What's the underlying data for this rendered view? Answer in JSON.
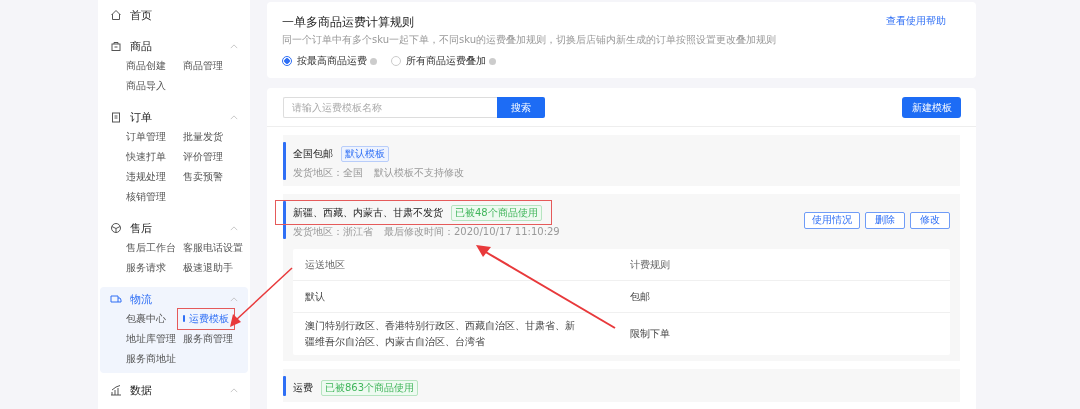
{
  "sidebar": {
    "items": [
      {
        "label": "首页",
        "expanded": false,
        "active": false
      },
      {
        "label": "商品",
        "expanded": true,
        "active": false,
        "children": [
          {
            "label": "商品创建",
            "selected": false
          },
          {
            "label": "商品管理",
            "selected": false
          },
          {
            "label": "商品导入",
            "selected": false
          }
        ]
      },
      {
        "label": "订单",
        "expanded": true,
        "active": false,
        "children": [
          {
            "label": "订单管理",
            "selected": false
          },
          {
            "label": "批量发货",
            "selected": false
          },
          {
            "label": "快速打单",
            "selected": false
          },
          {
            "label": "评价管理",
            "selected": false
          },
          {
            "label": "违规处理",
            "selected": false
          },
          {
            "label": "售卖预警",
            "selected": false
          },
          {
            "label": "核销管理",
            "selected": false
          }
        ]
      },
      {
        "label": "售后",
        "expanded": true,
        "active": false,
        "children": [
          {
            "label": "售后工作台",
            "selected": false
          },
          {
            "label": "客服电话设置",
            "selected": false
          },
          {
            "label": "服务请求",
            "selected": false
          },
          {
            "label": "极速退助手",
            "selected": false
          }
        ]
      },
      {
        "label": "物流",
        "expanded": true,
        "active": true,
        "children": [
          {
            "label": "包裹中心",
            "selected": false
          },
          {
            "label": "运费模板",
            "selected": true
          },
          {
            "label": "地址库管理",
            "selected": false
          },
          {
            "label": "服务商管理",
            "selected": false
          },
          {
            "label": "服务商地址",
            "selected": false
          }
        ]
      },
      {
        "label": "数据",
        "expanded": true,
        "active": false
      }
    ]
  },
  "rule_card": {
    "title": "一单多商品运费计算规则",
    "description": "同一个订单中有多个sku一起下单，不同sku的运费叠加规则，切换后店铺内新生成的订单按照设置更改叠加规则",
    "help_link": "查看使用帮助",
    "options": [
      {
        "label": "按最高商品运费",
        "selected": true
      },
      {
        "label": "所有商品运费叠加",
        "selected": false
      }
    ]
  },
  "search": {
    "placeholder": "请输入运费模板名称",
    "button": "搜索"
  },
  "new_button": "新建模板",
  "templates": [
    {
      "name": "全国包邮",
      "tag": {
        "label": "默认模板",
        "kind": "default"
      },
      "details": [
        "发货地区：全国",
        "默认模板不支持修改"
      ]
    },
    {
      "name": "新疆、西藏、内蒙古、甘肃不发货",
      "tag": {
        "label": "已被48个商品使用",
        "kind": "usage"
      },
      "details": [
        "发货地区：浙江省",
        "最后修改时间：2020/10/17 11:10:29"
      ],
      "actions": [
        "使用情况",
        "删除",
        "修改"
      ],
      "table": {
        "columns": [
          "运送地区",
          "计费规则"
        ],
        "rows": [
          [
            "默认",
            "包邮"
          ],
          [
            "澳门特别行政区、香港特别行政区、西藏自治区、甘肃省、新疆维吾尔自治区、内蒙古自治区、台湾省",
            "限制下单"
          ]
        ]
      }
    },
    {
      "name": "运费",
      "tag": {
        "label": "已被863个商品使用",
        "kind": "usage"
      }
    }
  ]
}
